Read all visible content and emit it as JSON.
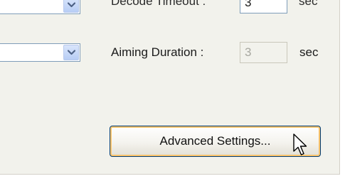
{
  "decode_timeout": {
    "label": "Decode Timeout :",
    "value": "3",
    "unit": "sec"
  },
  "aiming_duration": {
    "label": "Aiming Duration :",
    "value": "3",
    "unit": "sec",
    "enabled": false
  },
  "advanced_settings_button": {
    "label": "Advanced Settings..."
  },
  "icons": [
    "chevron-down-icon",
    "mouse-pointer-icon"
  ],
  "colors": {
    "panel_bg": "#f2f2ec",
    "button_border": "#003c74",
    "button_focus": "#f9c36b",
    "combo_arrow": "#4d6185"
  }
}
